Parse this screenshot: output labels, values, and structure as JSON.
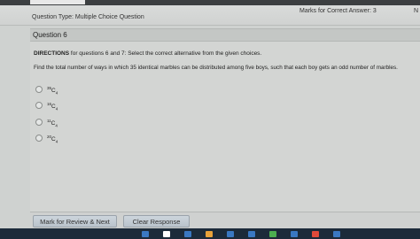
{
  "header": {
    "question_type": "Question Type: Multiple Choice Question",
    "marks": "Marks for Correct Answer: 3",
    "edge_letter": "N"
  },
  "question": {
    "title": "Question 6",
    "directions_label": "DIRECTIONS",
    "directions_text": " for questions 6 and 7: Select the correct alternative from the given choices.",
    "text": "Find the total number of ways in which 35 identical marbles can be distributed among five boys, such that each boy gets an odd number of marbles.",
    "options": [
      {
        "sup": "35",
        "base": "C",
        "sub": "4"
      },
      {
        "sup": "16",
        "base": "C",
        "sub": "4"
      },
      {
        "sup": "11",
        "base": "C",
        "sub": "4"
      },
      {
        "sup": "20",
        "base": "C",
        "sub": "4"
      }
    ]
  },
  "footer": {
    "review_label": "Mark for Review & Next",
    "clear_label": "Clear Response"
  },
  "taskbar": {
    "icon_colors": [
      "#3a78c2",
      "#ffffff",
      "#3a78c2",
      "#e8a23a",
      "#3a78c2",
      "#3a78c2",
      "#4caf50",
      "#3a78c2",
      "#e04a3a",
      "#3a78c2"
    ]
  }
}
